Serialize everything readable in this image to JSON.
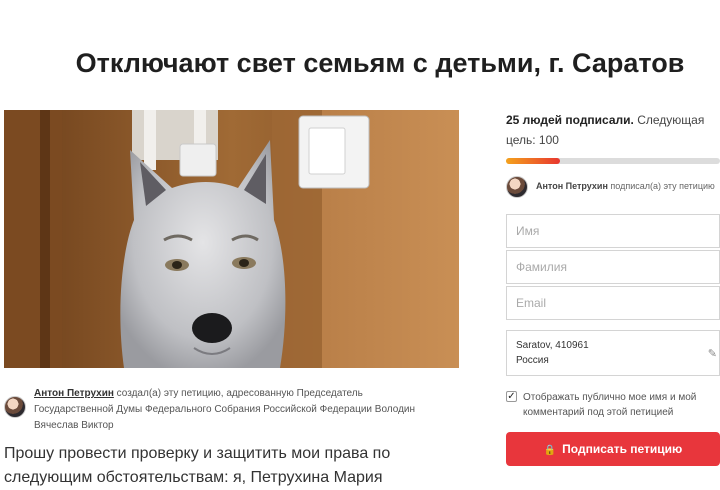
{
  "page": {
    "title": "Отключают свет семьям с детьми, г. Саратов"
  },
  "creator": {
    "name": "Антон Петрухин",
    "text_part1": " создал(а) эту петицию, адресованную Председатель",
    "text_part2": "Государственной Думы Федерального Собрания Российской Федерации Володин",
    "text_part3": "Вячеслав Виктор"
  },
  "petition": {
    "body_line1": "Прошу провести проверку и защитить мои права по",
    "body_line2": "следующим обстоятельствам: я, Петрухина Мария"
  },
  "signatures": {
    "count_text": "25 людей подписали.",
    "next_goal_text": " Следующая",
    "goal_line": "цель: 100",
    "count": 25,
    "goal": 100
  },
  "recent_signer": {
    "name": "Антон Петрухин",
    "action": " подписал(а) эту петицию"
  },
  "form": {
    "name_placeholder": "Имя",
    "surname_placeholder": "Фамилия",
    "email_placeholder": "Email",
    "location_line1": "Saratov, 410961",
    "location_line2": "Россия",
    "consent_label": "Отображать публично мое имя и мой комментарий под этой петицией",
    "consent_checked": true,
    "submit_label": "Подписать петицию"
  },
  "icons": {
    "lock": "lock-icon",
    "location_edit": "edit-icon",
    "check": "checkmark-icon"
  },
  "colors": {
    "submit_button": "#e8363c",
    "progress_start": "#f4a21d",
    "progress_end": "#e8362f"
  }
}
